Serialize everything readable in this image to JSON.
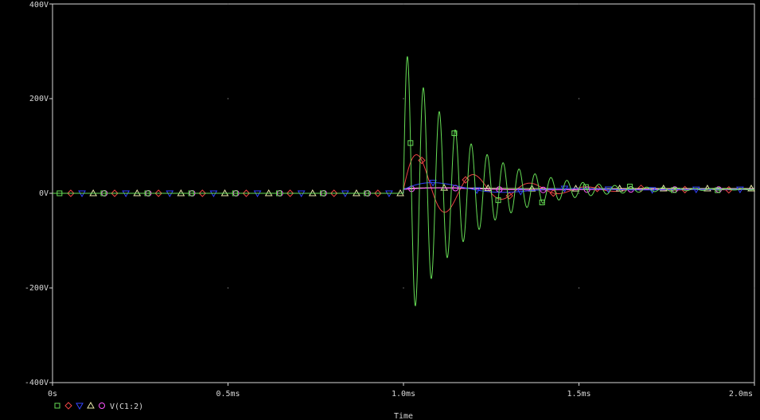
{
  "chart_data": {
    "type": "line",
    "title": "",
    "xlabel": "Time",
    "ylabel": "",
    "xlim": [
      0,
      2.0
    ],
    "ylim": [
      -400,
      400
    ],
    "x_unit": "ms",
    "y_unit": "V",
    "x_ticks": [
      {
        "value": 0,
        "label": "0s"
      },
      {
        "value": 0.5,
        "label": "0.5ms"
      },
      {
        "value": 1.0,
        "label": "1.0ms"
      },
      {
        "value": 1.5,
        "label": "1.5ms"
      },
      {
        "value": 2.0,
        "label": "2.0ms"
      }
    ],
    "y_ticks": [
      {
        "value": 400,
        "label": "400V"
      },
      {
        "value": 200,
        "label": "200V"
      },
      {
        "value": 0,
        "label": "0V"
      },
      {
        "value": -200,
        "label": "-200V"
      },
      {
        "value": -400,
        "label": "-400V"
      }
    ],
    "grid": "dots",
    "legend": {
      "placement": "bottom-left",
      "markers": [
        "square",
        "diamond",
        "triangle-down",
        "triangle-up",
        "circle"
      ],
      "label": "V(C1:2)"
    },
    "series": [
      {
        "marker": "square",
        "color": "#66dd55",
        "step_time": 1.0,
        "initial": 0,
        "final": 8,
        "amplitude": 300,
        "freq_khz": 22,
        "tau": 0.17
      },
      {
        "marker": "diamond",
        "color": "#ee4444",
        "step_time": 1.0,
        "initial": 0,
        "final": 8,
        "amplitude": 90,
        "freq_khz": 6.2,
        "tau": 0.19
      },
      {
        "marker": "triangle-down",
        "color": "#3344ff",
        "step_time": 1.0,
        "initial": 0,
        "final": 8,
        "amplitude": 22,
        "freq_khz": 2.5,
        "tau": 0.22
      },
      {
        "marker": "triangle-up",
        "color": "#e8e8aa",
        "step_time": 1.0,
        "initial": 0,
        "final": 10,
        "amplitude": 4,
        "freq_khz": 1.5,
        "tau": 0.15
      },
      {
        "marker": "circle",
        "color": "#ff55ff",
        "step_time": 1.0,
        "initial": 0,
        "final": 8,
        "amplitude": 6,
        "freq_khz": 1.8,
        "tau": 0.2
      }
    ]
  }
}
